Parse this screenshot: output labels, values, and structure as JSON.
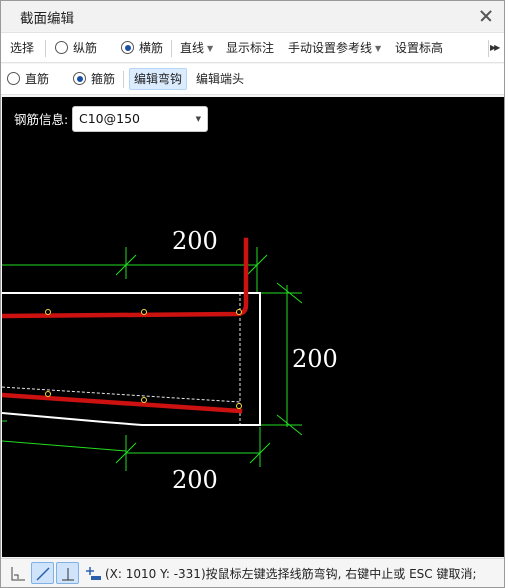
{
  "window": {
    "title": "截面编辑"
  },
  "toolbar1": {
    "select_label": "选择",
    "radio_longitudinal": "纵筋",
    "radio_transverse": "横筋",
    "line_label": "直线",
    "show_dims_label": "显示标注",
    "manual_ref_label": "手动设置参考线",
    "set_elev_label": "设置标高",
    "transverse_selected": true
  },
  "toolbar2": {
    "radio_straight": "直筋",
    "radio_stirrup": "箍筋",
    "edit_hook_label": "编辑弯钩",
    "edit_end_label": "编辑端头",
    "stirrup_selected": true
  },
  "canvas": {
    "rebar_info_label": "钢筋信息:",
    "rebar_info_value": "C10@150",
    "dim_top": "200",
    "dim_right": "200",
    "dim_bottom": "200",
    "colors": {
      "background": "#000000",
      "rebar": "#cc1111",
      "dimension": "#22dd22",
      "outline": "#ffffff"
    }
  },
  "statusbar": {
    "message": "(X: 1010 Y: -331)按鼠标左键选择线筋弯钩, 右键中止或 ESC 键取消;",
    "tools": [
      "ortho-icon",
      "free-line-icon",
      "perpendicular-icon",
      "add-point-icon"
    ]
  }
}
